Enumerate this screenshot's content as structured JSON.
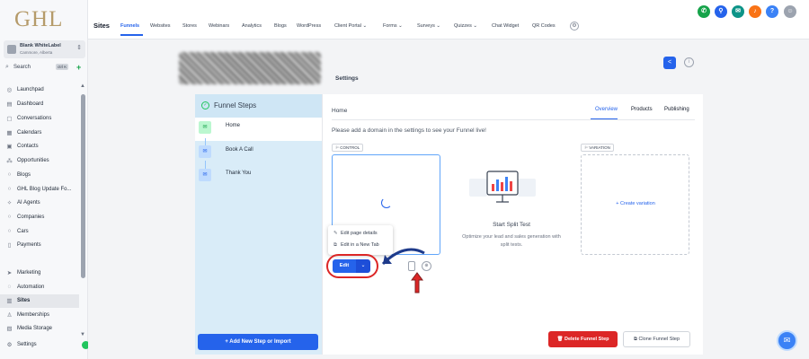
{
  "logo": "GHL",
  "account": {
    "name": "Blank WhiteLabel",
    "location": "Cammore, Alberta"
  },
  "search": {
    "label": "Search",
    "shortcut": "ctrl K"
  },
  "sidebar": {
    "items": [
      {
        "label": "Launchpad",
        "icon": "rocket-icon"
      },
      {
        "label": "Dashboard",
        "icon": "dashboard-icon"
      },
      {
        "label": "Conversations",
        "icon": "chat-icon"
      },
      {
        "label": "Calendars",
        "icon": "calendar-icon"
      },
      {
        "label": "Contacts",
        "icon": "contacts-icon"
      },
      {
        "label": "Opportunities",
        "icon": "opportunities-icon"
      },
      {
        "label": "Blogs",
        "icon": "blog-icon"
      },
      {
        "label": "GHL Blog Update Fo...",
        "icon": "blog-icon"
      },
      {
        "label": "AI Agents",
        "icon": "ai-icon"
      },
      {
        "label": "Companies",
        "icon": "company-icon"
      },
      {
        "label": "Cars",
        "icon": "car-icon"
      },
      {
        "label": "Payments",
        "icon": "payments-icon"
      },
      {
        "label": "Marketing",
        "icon": "marketing-icon"
      },
      {
        "label": "Automation",
        "icon": "automation-icon"
      },
      {
        "label": "Sites",
        "icon": "sites-icon"
      },
      {
        "label": "Memberships",
        "icon": "memberships-icon"
      },
      {
        "label": "Media Storage",
        "icon": "media-icon"
      },
      {
        "label": "Settings",
        "icon": "gear-icon"
      }
    ],
    "active": "Sites"
  },
  "topbar": {
    "section": "Sites",
    "tabs": [
      {
        "label": "Funnels"
      },
      {
        "label": "Websites"
      },
      {
        "label": "Stores"
      },
      {
        "label": "Webinars"
      },
      {
        "label": "Analytics"
      },
      {
        "label": "Blogs"
      },
      {
        "label": "WordPress"
      },
      {
        "label": "Client Portal ⌄"
      },
      {
        "label": "Forms ⌄"
      },
      {
        "label": "Surveys ⌄"
      },
      {
        "label": "Quizzes ⌄"
      },
      {
        "label": "Chat Widget"
      },
      {
        "label": "QR Codes"
      }
    ],
    "active_tab": "Funnels"
  },
  "page": {
    "settings_tab": "Settings"
  },
  "funnel_steps": {
    "title": "Funnel Steps",
    "steps": [
      {
        "label": "Home"
      },
      {
        "label": "Book A Call"
      },
      {
        "label": "Thank You"
      }
    ],
    "active": "Home",
    "add_button": "+ Add New Step or Import"
  },
  "content": {
    "page_name": "Home",
    "tabs": [
      {
        "label": "Overview"
      },
      {
        "label": "Products"
      },
      {
        "label": "Publishing"
      }
    ],
    "active_tab": "Overview",
    "notice": "Please add a domain in the settings to see your Funnel live!",
    "control_label": "CONTROL",
    "variation_label": "VARIATION",
    "menu": [
      {
        "label": "Edit page details"
      },
      {
        "label": "Edit in a New Tab"
      }
    ],
    "edit_button": "Edit",
    "split_test_title": "Start Split Test",
    "split_test_desc": "Optimize your lead and sales generation with split tests.",
    "create_variation": "+ Create variation",
    "delete_button": "Delete Funnel Step",
    "clone_button": "Clone Funnel Step"
  },
  "colors": {
    "accent": "#2563eb",
    "danger": "#dc2626",
    "steps_bg": "#d9ecf8",
    "logo": "#b59b6a"
  }
}
